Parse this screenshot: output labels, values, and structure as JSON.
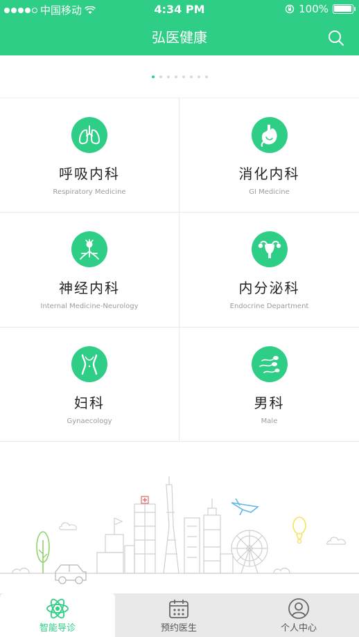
{
  "status_bar": {
    "carrier": "中国移动",
    "time": "4:34 PM",
    "battery": "100%",
    "battery_level": 1.0
  },
  "header": {
    "title": "弘医健康",
    "search_icon": "search-icon"
  },
  "carousel": {
    "page_count": 8,
    "active_index": 0
  },
  "departments": [
    {
      "name": "呼吸内科",
      "english": "Respiratory Medicine",
      "icon": "lungs-icon"
    },
    {
      "name": "消化内科",
      "english": "GI Medicine",
      "icon": "stomach-icon"
    },
    {
      "name": "神经内科",
      "english": "Internal Medicine-Neurology",
      "icon": "neuron-icon"
    },
    {
      "name": "内分泌科",
      "english": "Endocrine Department",
      "icon": "uterus-icon"
    },
    {
      "name": "妇科",
      "english": "Gynaecology",
      "icon": "female-torso-icon"
    },
    {
      "name": "男科",
      "english": "Male",
      "icon": "sperm-icon"
    }
  ],
  "tabbar": {
    "tabs": [
      {
        "label": "智能导诊",
        "icon": "atom-icon",
        "active": true
      },
      {
        "label": "预约医生",
        "icon": "calendar-icon",
        "active": false
      },
      {
        "label": "个人中心",
        "icon": "user-icon",
        "active": false
      }
    ]
  },
  "colors": {
    "brand": "#2fce86",
    "tabbar_bg": "#e9e9e9",
    "balloon": "#f5e66b",
    "plane": "#5bb8e8",
    "tree": "#8fd36a"
  }
}
